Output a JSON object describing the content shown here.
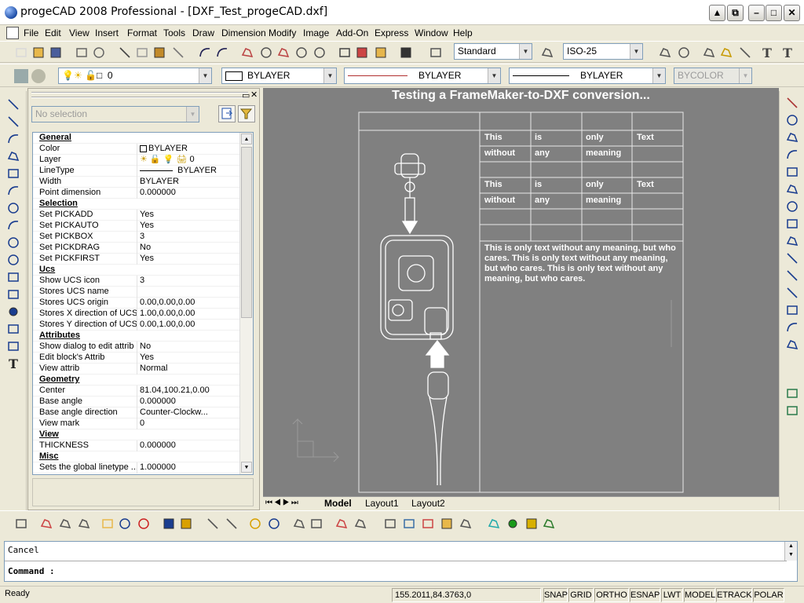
{
  "window": {
    "title": "progeCAD 2008 Professional - [DXF_Test_progeCAD.dxf]"
  },
  "menu": [
    "File",
    "Edit",
    "View",
    "Insert",
    "Format",
    "Tools",
    "Draw",
    "Dimension",
    "Modify",
    "Image",
    "Add-On",
    "Express",
    "Window",
    "Help"
  ],
  "toolbar1": {
    "text_style": "Standard",
    "dim_style": "ISO-25"
  },
  "toolbar2": {
    "layer_value": "0",
    "color": "BYLAYER",
    "linetype": "BYLAYER",
    "lineweight": "BYLAYER",
    "plotstyle": "BYCOLOR"
  },
  "properties": {
    "selection": "No selection",
    "rows": [
      {
        "k": "General",
        "v": "",
        "hdr": true
      },
      {
        "k": "Color",
        "v": "BYLAYER"
      },
      {
        "k": "Layer",
        "v": "0"
      },
      {
        "k": "LineType",
        "v": "BYLAYER"
      },
      {
        "k": "Width",
        "v": "BYLAYER"
      },
      {
        "k": "Point dimension",
        "v": "0.000000"
      },
      {
        "k": "Selection",
        "v": "",
        "hdr": true
      },
      {
        "k": "Set PICKADD",
        "v": "Yes"
      },
      {
        "k": "Set PICKAUTO",
        "v": "Yes"
      },
      {
        "k": "Set PICKBOX",
        "v": "3"
      },
      {
        "k": "Set PICKDRAG",
        "v": "No"
      },
      {
        "k": "Set PICKFIRST",
        "v": "Yes"
      },
      {
        "k": "Ucs",
        "v": "",
        "hdr": true
      },
      {
        "k": "Show UCS icon",
        "v": "3"
      },
      {
        "k": "Stores UCS name",
        "v": ""
      },
      {
        "k": "Stores UCS origin",
        "v": "0.00,0.00,0.00"
      },
      {
        "k": "Stores X direction of UCS",
        "v": "1.00,0.00,0.00"
      },
      {
        "k": "Stores Y direction of UCS",
        "v": "0.00,1.00,0.00"
      },
      {
        "k": "Attributes",
        "v": "",
        "hdr": true
      },
      {
        "k": "Show dialog to edit attrib",
        "v": "No"
      },
      {
        "k": "Edit block's Attrib",
        "v": "Yes"
      },
      {
        "k": "View attrib",
        "v": "Normal"
      },
      {
        "k": "Geometry",
        "v": "",
        "hdr": true
      },
      {
        "k": "Center",
        "v": "81.04,100.21,0.00"
      },
      {
        "k": "Base angle",
        "v": "0.000000"
      },
      {
        "k": "Base angle direction",
        "v": "Counter-Clockw..."
      },
      {
        "k": "View mark",
        "v": "0"
      },
      {
        "k": "View",
        "v": "",
        "hdr": true
      },
      {
        "k": "THICKNESS",
        "v": "0.000000"
      },
      {
        "k": "Misc",
        "v": "",
        "hdr": true
      },
      {
        "k": "Sets the global linetype ...",
        "v": "1.000000"
      }
    ]
  },
  "drawing": {
    "heading": "Testing a FrameMaker-to-DXF conversion...",
    "table_rows": [
      [
        "This",
        "is",
        "only",
        "Text"
      ],
      [
        "without",
        "any",
        "meaning",
        ""
      ],
      [
        "",
        "",
        "",
        ""
      ],
      [
        "This",
        "is",
        "only",
        "Text"
      ],
      [
        "without",
        "any",
        "meaning",
        ""
      ],
      [
        "",
        "",
        "",
        ""
      ]
    ],
    "paragraph": "This is only text without any meaning, but who cares. This is only text without any meaning, but who cares. This is only text without any meaning, but who cares."
  },
  "layout_tabs": [
    "Model",
    "Layout1",
    "Layout2"
  ],
  "command": {
    "history": "Cancel",
    "prompt": "Command :"
  },
  "status": {
    "ready": "Ready",
    "coords": "155.2011,84.3763,0",
    "toggles": [
      "SNAP",
      "GRID",
      "ORTHO",
      "ESNAP",
      "LWT",
      "MODEL",
      "ETRACK",
      "POLAR"
    ]
  }
}
